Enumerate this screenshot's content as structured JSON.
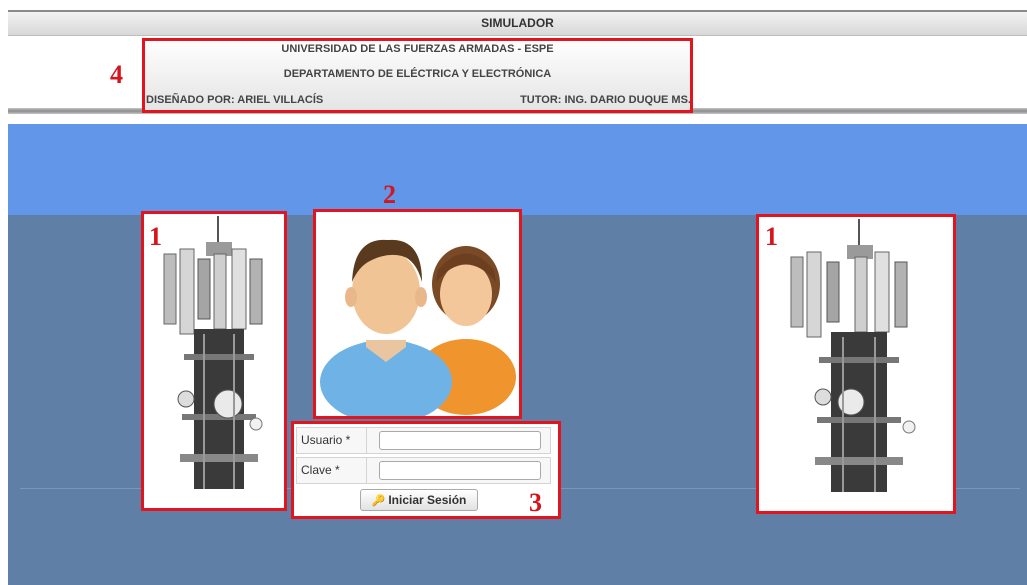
{
  "header": {
    "title": "SIMULADOR",
    "university": "UNIVERSIDAD DE LAS FUERZAS ARMADAS - ESPE",
    "department": "DEPARTAMENTO DE ELÉCTRICA Y ELECTRÓNICA",
    "designer": "DISEÑADO POR: ARIEL VILLACÍS",
    "tutor": "TUTOR: ING. DARIO DUQUE MS."
  },
  "annotations": {
    "towers_left": "1",
    "avatar": "2",
    "login": "3",
    "tower_right": "1",
    "header": "4"
  },
  "login": {
    "user_label": "Usuario *",
    "user_value": "",
    "password_label": "Clave *",
    "password_value": "",
    "submit_label": "Iniciar Sesión",
    "submit_icon": "key-icon"
  },
  "colors": {
    "annotation_red": "#e2141e",
    "sky": "#6296e9",
    "background": "#5f7fa6"
  }
}
